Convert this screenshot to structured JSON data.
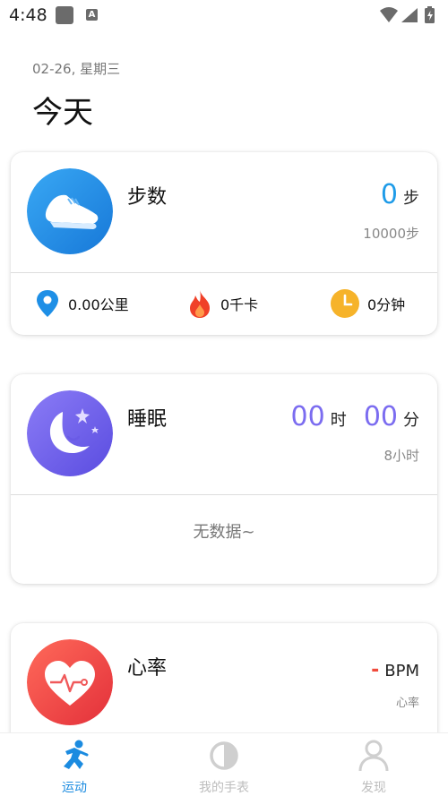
{
  "status_bar": {
    "time": "4:48",
    "notification_letter": "A"
  },
  "header": {
    "date": "02-26, 星期三",
    "title": "今天"
  },
  "steps_card": {
    "label": "步数",
    "value": "0",
    "unit": "步",
    "goal": "10000步",
    "distance": "0.00公里",
    "calories": "0千卡",
    "duration": "0分钟",
    "accent": "#1e9be8"
  },
  "sleep_card": {
    "label": "睡眠",
    "hours": "00",
    "hours_unit": "时",
    "minutes": "00",
    "minutes_unit": "分",
    "goal": "8小时",
    "empty_text": "无数据~",
    "accent": "#7b6cf0"
  },
  "heart_card": {
    "label": "心率",
    "value": "-",
    "unit": "BPM",
    "sub": "心率",
    "accent": "#f04b3c"
  },
  "tabs": [
    {
      "label": "运动",
      "icon": "runner-icon",
      "active": true
    },
    {
      "label": "我的手表",
      "icon": "watch-icon",
      "active": false
    },
    {
      "label": "发现",
      "icon": "person-icon",
      "active": false
    }
  ],
  "colors": {
    "tab_active": "#1b8be0",
    "tab_inactive": "#bdbdbd"
  }
}
